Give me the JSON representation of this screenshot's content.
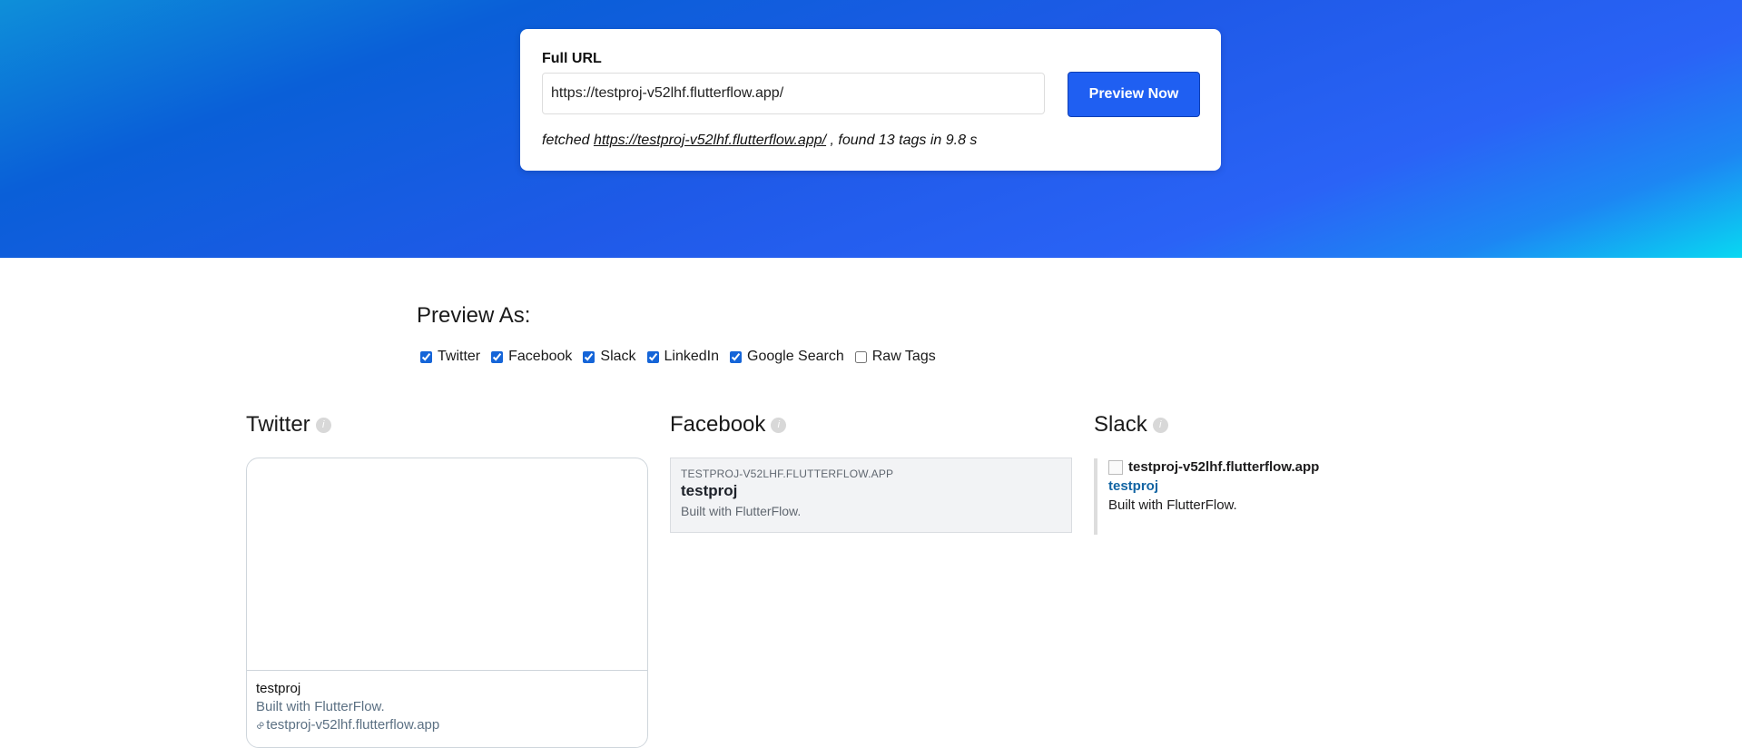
{
  "form": {
    "label": "Full URL",
    "url_value": "https://testproj-v52lhf.flutterflow.app/",
    "button_label": "Preview Now",
    "status_prefix": "fetched",
    "status_link": "https://testproj-v52lhf.flutterflow.app/",
    "status_suffix": ", found 13 tags in 9.8 s"
  },
  "preview_as": {
    "heading": "Preview As:",
    "options": [
      {
        "label": "Twitter",
        "checked": true
      },
      {
        "label": "Facebook",
        "checked": true
      },
      {
        "label": "Slack",
        "checked": true
      },
      {
        "label": "LinkedIn",
        "checked": true
      },
      {
        "label": "Google Search",
        "checked": true
      },
      {
        "label": "Raw Tags",
        "checked": false
      }
    ]
  },
  "twitter": {
    "heading": "Twitter",
    "title": "testproj",
    "description": "Built with FlutterFlow.",
    "domain": "testproj-v52lhf.flutterflow.app"
  },
  "facebook": {
    "heading": "Facebook",
    "domain": "TESTPROJ-V52LHF.FLUTTERFLOW.APP",
    "title": "testproj",
    "description": "Built with FlutterFlow."
  },
  "slack": {
    "heading": "Slack",
    "site": "testproj-v52lhf.flutterflow.app",
    "title": "testproj",
    "description": "Built with FlutterFlow."
  },
  "icons": {
    "info": "info-icon",
    "link": "link-icon",
    "favicon": "broken-image-icon"
  }
}
